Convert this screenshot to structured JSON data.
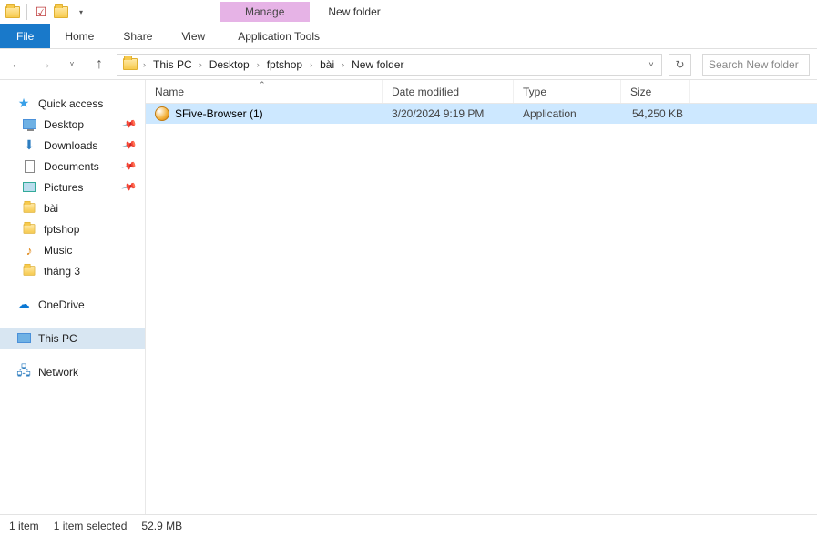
{
  "title": "New folder",
  "ribbon": {
    "manage": "Manage",
    "tabs": {
      "file": "File",
      "home": "Home",
      "share": "Share",
      "view": "View",
      "app_tools": "Application Tools"
    }
  },
  "breadcrumbs": [
    "This PC",
    "Desktop",
    "fptshop",
    "bài",
    "New folder"
  ],
  "search_placeholder": "Search New folder",
  "columns": {
    "name": "Name",
    "date": "Date modified",
    "type": "Type",
    "size": "Size"
  },
  "sidebar": {
    "quick_access": "Quick access",
    "pinned": [
      {
        "label": "Desktop",
        "icon": "desktop"
      },
      {
        "label": "Downloads",
        "icon": "down"
      },
      {
        "label": "Documents",
        "icon": "doc"
      },
      {
        "label": "Pictures",
        "icon": "pic"
      }
    ],
    "recent": [
      {
        "label": "bài"
      },
      {
        "label": "fptshop"
      },
      {
        "label": "Music",
        "icon": "music"
      },
      {
        "label": "tháng 3"
      }
    ],
    "onedrive": "OneDrive",
    "this_pc": "This PC",
    "network": "Network"
  },
  "files": [
    {
      "name": "SFive-Browser (1)",
      "date": "3/20/2024 9:19 PM",
      "type": "Application",
      "size": "54,250 KB"
    }
  ],
  "status": {
    "count": "1 item",
    "selected": "1 item selected",
    "size": "52.9 MB"
  }
}
